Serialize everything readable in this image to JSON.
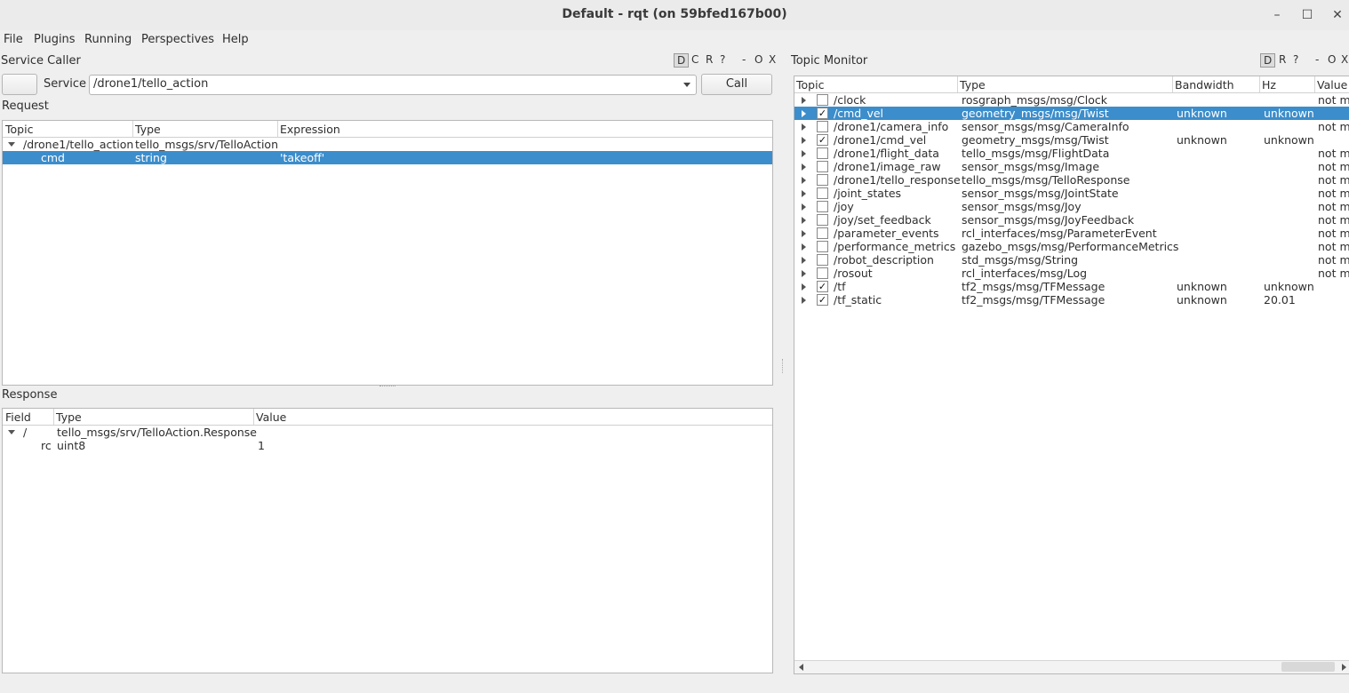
{
  "window": {
    "title": "Default - rqt (on 59bfed167b00)",
    "min_glyph": "–",
    "max_glyph": "☐",
    "close_glyph": "✕"
  },
  "menubar": [
    {
      "label": "File"
    },
    {
      "label": "Plugins"
    },
    {
      "label": "Running"
    },
    {
      "label": "Perspectives"
    },
    {
      "label": "Help"
    }
  ],
  "service_caller": {
    "title": "Service Caller",
    "header_buttons": [
      "D",
      "C",
      "R",
      "?",
      "-",
      "O",
      "X"
    ],
    "service_label": "Service",
    "service_value": "/drone1/tello_action",
    "call_label": "Call",
    "request_label": "Request",
    "request_columns": [
      "Topic",
      "Type",
      "Expression"
    ],
    "request_rows": [
      {
        "topic": "/drone1/tello_action",
        "type": "tello_msgs/srv/TelloAction",
        "expression": ""
      },
      {
        "topic": "cmd",
        "type": "string",
        "expression": "'takeoff'"
      }
    ],
    "response_label": "Response",
    "response_columns": [
      "Field",
      "Type",
      "Value"
    ],
    "response_rows": [
      {
        "field": "/",
        "type": "tello_msgs/srv/TelloAction.Response",
        "value": ""
      },
      {
        "field": "rc",
        "type": "uint8",
        "value": "1"
      }
    ]
  },
  "topic_monitor": {
    "title": "Topic Monitor",
    "header_buttons": [
      "D",
      "R",
      "?",
      "-",
      "O",
      "X"
    ],
    "columns": [
      "Topic",
      "Type",
      "Bandwidth",
      "Hz",
      "Value"
    ],
    "rows": [
      {
        "topic": "/clock",
        "type": "rosgraph_msgs/msg/Clock",
        "checked": false,
        "bandwidth": "",
        "hz": "",
        "value": "not m"
      },
      {
        "topic": "/cmd_vel",
        "type": "geometry_msgs/msg/Twist",
        "checked": true,
        "bandwidth": "unknown",
        "hz": "unknown",
        "value": ""
      },
      {
        "topic": "/drone1/camera_info",
        "type": "sensor_msgs/msg/CameraInfo",
        "checked": false,
        "bandwidth": "",
        "hz": "",
        "value": "not m"
      },
      {
        "topic": "/drone1/cmd_vel",
        "type": "geometry_msgs/msg/Twist",
        "checked": true,
        "bandwidth": "unknown",
        "hz": "unknown",
        "value": ""
      },
      {
        "topic": "/drone1/flight_data",
        "type": "tello_msgs/msg/FlightData",
        "checked": false,
        "bandwidth": "",
        "hz": "",
        "value": "not m"
      },
      {
        "topic": "/drone1/image_raw",
        "type": "sensor_msgs/msg/Image",
        "checked": false,
        "bandwidth": "",
        "hz": "",
        "value": "not m"
      },
      {
        "topic": "/drone1/tello_response",
        "type": "tello_msgs/msg/TelloResponse",
        "checked": false,
        "bandwidth": "",
        "hz": "",
        "value": "not m"
      },
      {
        "topic": "/joint_states",
        "type": "sensor_msgs/msg/JointState",
        "checked": false,
        "bandwidth": "",
        "hz": "",
        "value": "not m"
      },
      {
        "topic": "/joy",
        "type": "sensor_msgs/msg/Joy",
        "checked": false,
        "bandwidth": "",
        "hz": "",
        "value": "not m"
      },
      {
        "topic": "/joy/set_feedback",
        "type": "sensor_msgs/msg/JoyFeedback",
        "checked": false,
        "bandwidth": "",
        "hz": "",
        "value": "not m"
      },
      {
        "topic": "/parameter_events",
        "type": "rcl_interfaces/msg/ParameterEvent",
        "checked": false,
        "bandwidth": "",
        "hz": "",
        "value": "not m"
      },
      {
        "topic": "/performance_metrics",
        "type": "gazebo_msgs/msg/PerformanceMetrics",
        "checked": false,
        "bandwidth": "",
        "hz": "",
        "value": "not m"
      },
      {
        "topic": "/robot_description",
        "type": "std_msgs/msg/String",
        "checked": false,
        "bandwidth": "",
        "hz": "",
        "value": "not m"
      },
      {
        "topic": "/rosout",
        "type": "rcl_interfaces/msg/Log",
        "checked": false,
        "bandwidth": "",
        "hz": "",
        "value": "not m"
      },
      {
        "topic": "/tf",
        "type": "tf2_msgs/msg/TFMessage",
        "checked": true,
        "bandwidth": "unknown",
        "hz": "unknown",
        "value": ""
      },
      {
        "topic": "/tf_static",
        "type": "tf2_msgs/msg/TFMessage",
        "checked": true,
        "bandwidth": "unknown",
        "hz": "20.01",
        "value": ""
      }
    ],
    "selected_row": 1,
    "check_glyph": "✓"
  }
}
